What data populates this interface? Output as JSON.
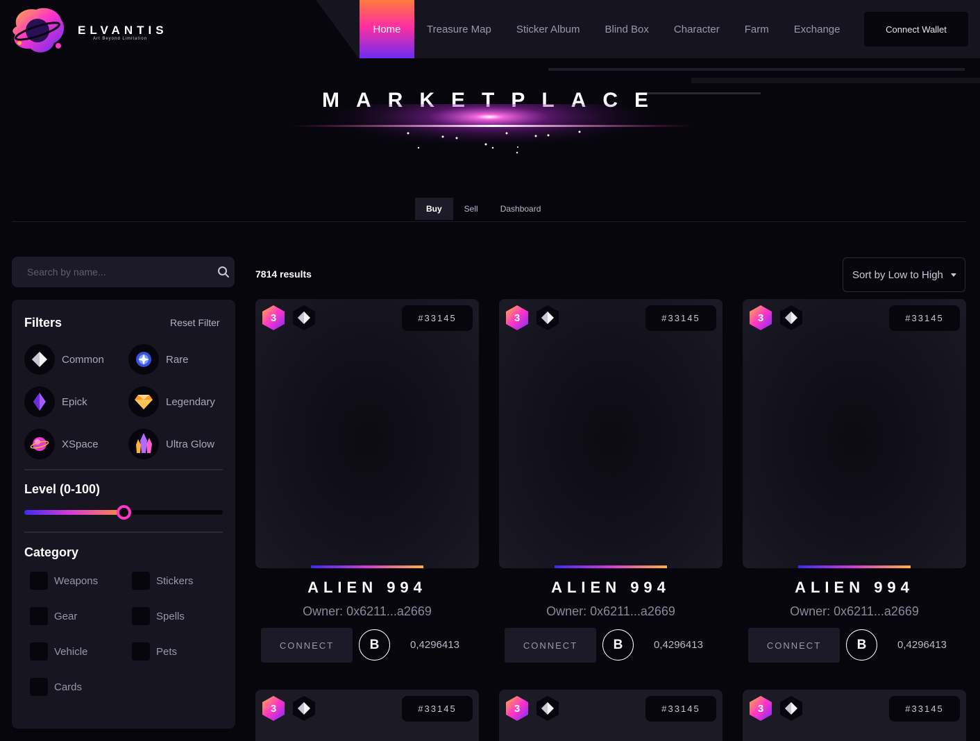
{
  "brand": {
    "name": "ELVANTIS",
    "tagline": "Art Beyond Limitation"
  },
  "nav": {
    "items": [
      {
        "label": "Home",
        "active": true
      },
      {
        "label": "Treasure Map"
      },
      {
        "label": "Sticker Album"
      },
      {
        "label": "Blind Box"
      },
      {
        "label": "Character"
      },
      {
        "label": "Farm"
      },
      {
        "label": "Exchange"
      }
    ],
    "connect_wallet": "Connect Wallet"
  },
  "hero": {
    "title": "MARKETPLACE"
  },
  "tabs": [
    {
      "label": "Buy",
      "active": true
    },
    {
      "label": "Sell"
    },
    {
      "label": "Dashboard"
    }
  ],
  "search": {
    "placeholder": "Search by name...",
    "icon": "search-icon"
  },
  "filters": {
    "title": "Filters",
    "reset": "Reset Filter",
    "rarities": [
      {
        "label": "Common",
        "icon": "white-diamond-icon"
      },
      {
        "label": "Rare",
        "icon": "blue-star-orb-icon"
      },
      {
        "label": "Epick",
        "icon": "purple-crystal-icon"
      },
      {
        "label": "Legendary",
        "icon": "orange-gem-icon"
      },
      {
        "label": "XSpace",
        "icon": "planet-icon"
      },
      {
        "label": "Ultra Glow",
        "icon": "glowing-crystal-cluster-icon"
      }
    ],
    "level": {
      "title": "Level (0-100)",
      "min": 0,
      "max": 100,
      "value": 50
    },
    "category": {
      "title": "Category",
      "items": [
        "Weapons",
        "Stickers",
        "Gear",
        "Spells",
        "Vehicle",
        "Pets",
        "Cards"
      ]
    }
  },
  "results": {
    "count_text": "7814 results",
    "sort_label": "Sort by Low to High"
  },
  "cards": [
    {
      "level": "3",
      "id": "#33145",
      "name": "ALIEN 994",
      "owner": "Owner: 0x6211...a2669",
      "button": "CONNECT",
      "currency_symbol": "B",
      "price": "0,4296413"
    },
    {
      "level": "3",
      "id": "#33145",
      "name": "ALIEN 994",
      "owner": "Owner: 0x6211...a2669",
      "button": "CONNECT",
      "currency_symbol": "B",
      "price": "0,4296413"
    },
    {
      "level": "3",
      "id": "#33145",
      "name": "ALIEN 994",
      "owner": "Owner: 0x6211...a2669",
      "button": "CONNECT",
      "currency_symbol": "B",
      "price": "0,4296413"
    },
    {
      "level": "3",
      "id": "#33145"
    },
    {
      "level": "3",
      "id": "#33145"
    },
    {
      "level": "3",
      "id": "#33145"
    }
  ],
  "colors": {
    "background": "#07060d",
    "panel": "#161520",
    "accent_pink": "#ff35c9",
    "accent_orange": "#ff8c3a",
    "accent_violet": "#3b2cf5"
  }
}
